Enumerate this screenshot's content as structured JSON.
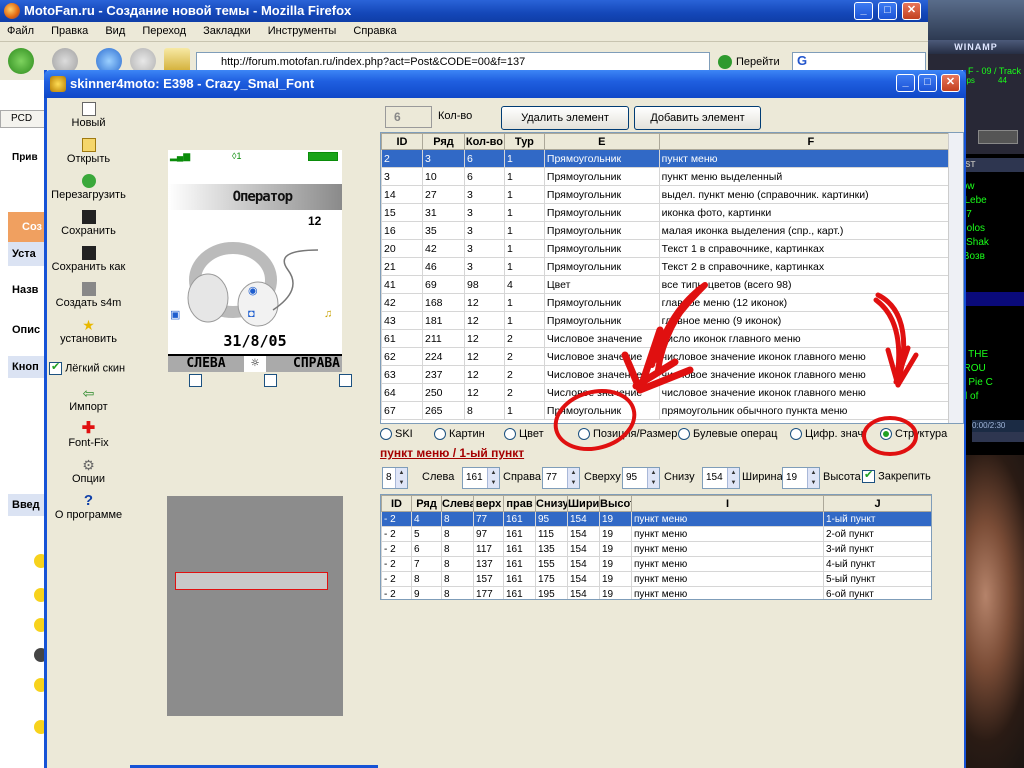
{
  "firefox": {
    "title": "MotoFan.ru - Создание новой темы - Mozilla Firefox",
    "menu": [
      "Файл",
      "Правка",
      "Вид",
      "Переход",
      "Закладки",
      "Инструменты",
      "Справка"
    ],
    "url": "http://forum.motofan.ru/index.php?act=Post&CODE=00&f=137",
    "go_label": "Перейти",
    "search_letter": "G",
    "left_strip": [
      "PCD",
      "Прив",
      "Соз",
      "Уста",
      "Назв",
      "Опис",
      "Кноп",
      "Введ"
    ]
  },
  "winamp": {
    "title": "WINAMP",
    "track_info": "F - 09 / Track",
    "kbps": "kbps",
    "khz": "44",
    "playlist_title": "P PLAYLIST",
    "playlist": [
      "nna Know",
      "chiller / Lebe",
      "рожка 07",
      "oyal Gigolos",
      "cooter / Shak",
      "mash / Boзв",
      "rack 03",
      "rack 06",
      "rack 09",
      "rack 11",
      "rack 12"
    ],
    "playlist2": [
      " COVER THE",
      "UMPATROU",
      "merican Pie C",
      "e Sound of"
    ],
    "time": "0:00/2:30"
  },
  "app": {
    "title": "skinner4moto: E398 - Crazy_Smal_Font",
    "toolbar": [
      {
        "label": "Новый",
        "icon": "new-file-icon"
      },
      {
        "label": "Открыть",
        "icon": "open-folder-icon"
      },
      {
        "label": "Перезагрузить",
        "icon": "reload-icon"
      },
      {
        "label": "Сохранить",
        "icon": "save-icon"
      },
      {
        "label": "Сохранить как",
        "icon": "save-as-icon"
      },
      {
        "label": "Создать s4m",
        "icon": "create-s4m-icon"
      },
      {
        "label": "установить",
        "icon": "install-star-icon"
      }
    ],
    "toolbar2": [
      {
        "label": "Импорт",
        "icon": "import-arrow-icon"
      },
      {
        "label": "Font-Fix",
        "icon": "font-fix-cross-icon"
      },
      {
        "label": "Опции",
        "icon": "options-gears-icon"
      },
      {
        "label": "О программе",
        "icon": "help-question-icon"
      }
    ],
    "light_skin_label": "Лёгкий скин",
    "light_skin_checked": true
  },
  "phone": {
    "operator": "Оператор",
    "clock": "12",
    "date": "31/8/05",
    "soft_left": "СЛЕВА",
    "soft_center": "☼",
    "soft_right": "СПРАВА"
  },
  "panel": {
    "count_value": "6",
    "count_label": "Кол-во",
    "delete_btn": "Удалить элемент",
    "add_btn": "Добавить элемент",
    "columns": [
      "ID",
      "Ряд",
      "Кол-во",
      "Тур",
      "E",
      "F"
    ],
    "rows": [
      [
        "2",
        "3",
        "6",
        "1",
        "Прямоугольник",
        "пункт меню"
      ],
      [
        "3",
        "10",
        "6",
        "1",
        "Прямоугольник",
        "пункт меню выделенный"
      ],
      [
        "14",
        "27",
        "3",
        "1",
        "Прямоугольник",
        "выдел. пункт меню (справочник. картинки)"
      ],
      [
        "15",
        "31",
        "3",
        "1",
        "Прямоугольник",
        "иконка фото, картинки"
      ],
      [
        "16",
        "35",
        "3",
        "1",
        "Прямоугольник",
        "малая иконка выделения (спр., карт.)"
      ],
      [
        "20",
        "42",
        "3",
        "1",
        "Прямоугольник",
        "Текст 1 в справочнике, картинках"
      ],
      [
        "21",
        "46",
        "3",
        "1",
        "Прямоугольник",
        "Текст 2 в справочнике, картинках"
      ],
      [
        "41",
        "69",
        "98",
        "4",
        "Цвет",
        "все типы цветов (всего 98)"
      ],
      [
        "42",
        "168",
        "12",
        "1",
        "Прямоугольник",
        "главное меню (12 иконок)"
      ],
      [
        "43",
        "181",
        "12",
        "1",
        "Прямоугольник",
        "главное меню (9 иконок)"
      ],
      [
        "61",
        "211",
        "12",
        "2",
        "Числовое значение",
        "число иконок главного меню"
      ],
      [
        "62",
        "224",
        "12",
        "2",
        "Числовое значение",
        "числовое значение иконок главного меню"
      ],
      [
        "63",
        "237",
        "12",
        "2",
        "Числовое значение",
        "числовое значение иконок главного меню"
      ],
      [
        "64",
        "250",
        "12",
        "2",
        "Числовое значение",
        "числовое значение иконок главного меню"
      ],
      [
        "67",
        "265",
        "8",
        "1",
        "Прямоугольник",
        "прямоугольник обычного пункта меню"
      ]
    ],
    "radios": [
      "SKI",
      "Картин",
      "Цвет",
      "Позиция/Размер",
      "Булевые операц",
      "Цифр. знач",
      "Структура"
    ],
    "radio_selected": "Структура",
    "sub_title": "пункт меню / 1-ый пункт",
    "fields": [
      {
        "value": "8",
        "label": "Слева"
      },
      {
        "value": "161",
        "label": "Справа"
      },
      {
        "value": "77",
        "label": "Сверху"
      },
      {
        "value": "95",
        "label": "Снизу"
      },
      {
        "value": "154",
        "label": "Ширина"
      },
      {
        "value": "19",
        "label": "Высота"
      }
    ],
    "lock_label": "Закрепить",
    "lock_checked": true,
    "columns2": [
      "ID",
      "Ряд",
      "Слева",
      "верх",
      "прав",
      "Снизу",
      "Ширина",
      "Высота",
      "I",
      "J"
    ],
    "rows2": [
      [
        "- 2",
        "4",
        "8",
        "77",
        "161",
        "95",
        "154",
        "19",
        "пункт меню",
        "1-ый пункт"
      ],
      [
        "- 2",
        "5",
        "8",
        "97",
        "161",
        "115",
        "154",
        "19",
        "пункт меню",
        "2-ой пункт"
      ],
      [
        "- 2",
        "6",
        "8",
        "117",
        "161",
        "135",
        "154",
        "19",
        "пункт меню",
        "3-ий пункт"
      ],
      [
        "- 2",
        "7",
        "8",
        "137",
        "161",
        "155",
        "154",
        "19",
        "пункт меню",
        "4-ый пункт"
      ],
      [
        "- 2",
        "8",
        "8",
        "157",
        "161",
        "175",
        "154",
        "19",
        "пункт меню",
        "5-ый пункт"
      ],
      [
        "- 2",
        "9",
        "8",
        "177",
        "161",
        "195",
        "154",
        "19",
        "пункт меню",
        "6-ой пункт"
      ]
    ]
  },
  "colors": {
    "xp_blue": "#1f5fe0",
    "selection": "#3169c6",
    "annotation_red": "#e01010",
    "winamp_green": "#1aff1a"
  }
}
